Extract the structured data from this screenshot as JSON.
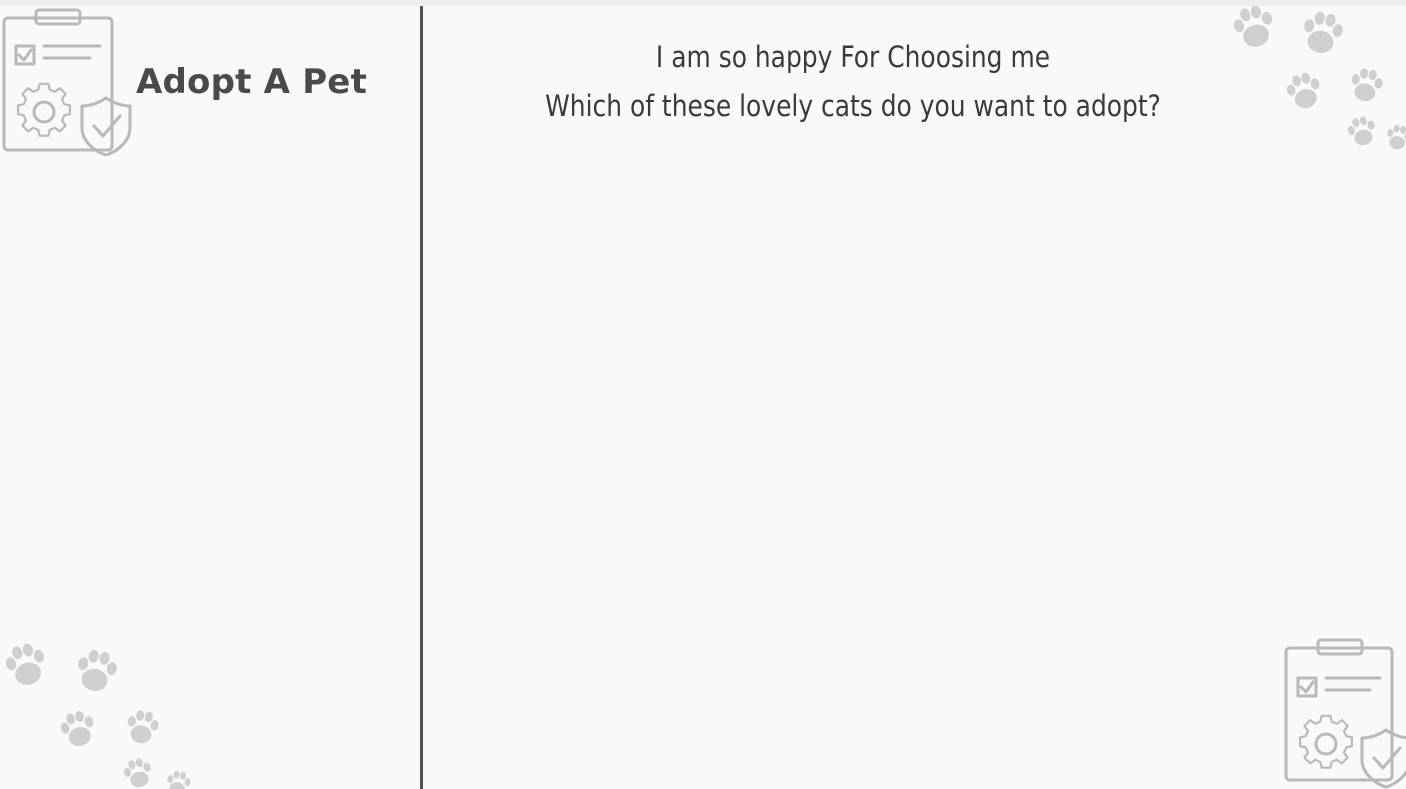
{
  "app": {
    "brand_title": "Adopt A Pet"
  },
  "main": {
    "heading_line1": "I am so happy For Choosing me",
    "heading_line2": "Which of these lovely cats do you want to adopt?"
  },
  "icons": {
    "brand_logo": "clipboard-gear-shield-icon",
    "paws": "paw-print-icon"
  },
  "colors": {
    "background": "#f9f9f9",
    "divider": "#505050",
    "text": "#3a3a3a",
    "icon_gray": "#b9b9b9"
  }
}
